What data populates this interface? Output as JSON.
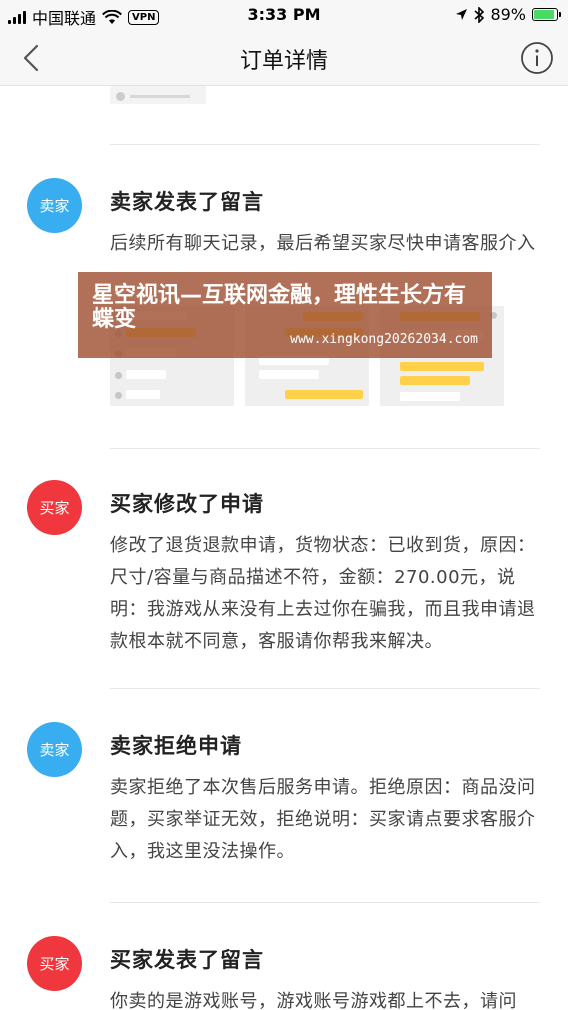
{
  "status_bar": {
    "carrier": "中国联通",
    "vpn": "VPN",
    "time": "3:33 PM",
    "battery_percent": "89%",
    "battery_level": 0.89
  },
  "nav": {
    "title": "订单详情",
    "back_icon": "chevron-left-icon",
    "info_icon": "info-icon"
  },
  "entries": [
    {
      "role": "seller",
      "avatar_label": "卖家",
      "title": "卖家发表了留言",
      "body": "后续所有聊天记录，最后希望买家尽快申请客服介入"
    },
    {
      "role": "buyer",
      "avatar_label": "买家",
      "title": "买家修改了申请",
      "body": "修改了退货退款申请，货物状态：已收到货，原因：尺寸/容量与商品描述不符，金额：270.00元，说明：我游戏从来没有上去过你在骗我，而且我申请退款根本就不同意，客服请你帮我来解决。"
    },
    {
      "role": "seller",
      "avatar_label": "卖家",
      "title": "卖家拒绝申请",
      "body": "卖家拒绝了本次售后服务申请。拒绝原因：商品没问题，买家举证无效，拒绝说明：买家请点要求客服介入，我这里没法操作。"
    },
    {
      "role": "buyer",
      "avatar_label": "买家",
      "title": "买家发表了留言",
      "body": "你卖的是游戏账号，游戏账号游戏都上不去，请问"
    }
  ],
  "watermark": {
    "title": "星空视讯—互联网金融，理性生长方有蝶变",
    "url": "www.xingkong20262034.com"
  },
  "colors": {
    "seller_avatar": "#38aef0",
    "buyer_avatar": "#f0373d",
    "watermark_bg": "#a05234",
    "chat_bubble": "#ffd04a"
  }
}
